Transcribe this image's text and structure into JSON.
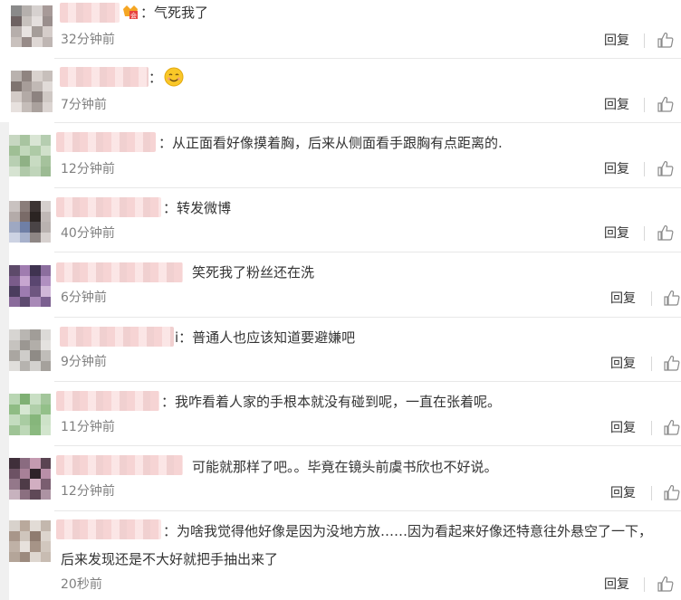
{
  "colors": {
    "reply_text": "#333333",
    "time_text": "#808080",
    "divider": "#e8e8e8"
  },
  "comments": [
    {
      "text": "：气死我了",
      "time": "32分钟前",
      "reply": "回复",
      "emoji": "vip-badge-icon"
    },
    {
      "text": "：",
      "time": "7分钟前",
      "reply": "回复",
      "emoji": "smile-emoji-icon"
    },
    {
      "text": "：从正面看好像摸着胸，后来从侧面看手跟胸有点距离的.",
      "time": "12分钟前",
      "reply": "回复"
    },
    {
      "text": "：转发微博",
      "time": "40分钟前",
      "reply": "回复"
    },
    {
      "text": "笑死我了粉丝还在洗",
      "time": "6分钟前",
      "reply": "回复"
    },
    {
      "text": "i：普通人也应该知道要避嫌吧",
      "time": "9分钟前",
      "reply": "回复"
    },
    {
      "text": "：我咋看着人家的手根本就没有碰到呢，一直在张着呢。",
      "time": "11分钟前",
      "reply": "回复"
    },
    {
      "text": "可能就那样了吧。。毕竟在镜头前虞书欣也不好说。",
      "time": "12分钟前",
      "reply": "回复"
    },
    {
      "text": "：为啥我觉得他好像是因为没地方放……因为看起来好像还特意往外悬空了一下，",
      "text2": "后来发现还是不大好就把手抽出来了",
      "time": "20秒前",
      "reply": "回复"
    }
  ]
}
